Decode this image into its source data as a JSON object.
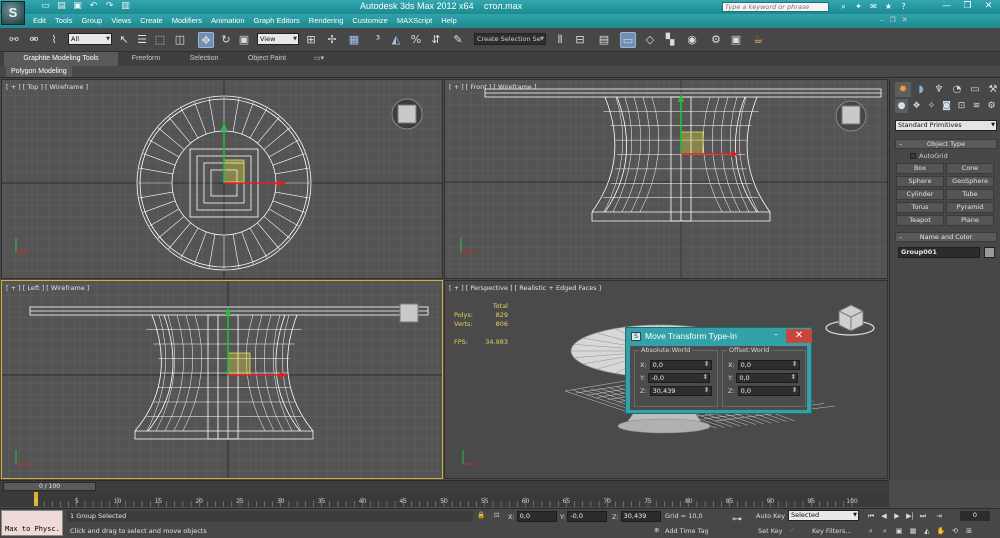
{
  "app": {
    "logo_glyph": "S",
    "title": "Autodesk 3ds Max  2012 x64",
    "file": "стол.max",
    "search_placeholder": "Type a keyword or phrase"
  },
  "menu": [
    "Edit",
    "Tools",
    "Group",
    "Views",
    "Create",
    "Modifiers",
    "Animation",
    "Graph Editors",
    "Rendering",
    "Customize",
    "MAXScript",
    "Help"
  ],
  "toolbar": {
    "selection_filter": "All",
    "ref_coord": "View",
    "named_selection": "Create Selection Se"
  },
  "ribbon": {
    "tabs": [
      "Graphite Modeling Tools",
      "Freeform",
      "Selection",
      "Object Paint"
    ],
    "active_tab": 0,
    "panel_label": "Polygon Modeling"
  },
  "viewports": {
    "top": "[ + ] [ Top ] [ Wireframe ]",
    "front": "[ + ] [ Front ] [ Wireframe ]",
    "left": "[ + ] [ Left ] [ Wireframe ]",
    "perspective": "[ + ] [ Perspective ] [ Realistic + Edged Faces ]",
    "viewcube_top": "TOP",
    "viewcube_front": "FRONT",
    "viewcube_left": "LEFT"
  },
  "stats": {
    "total_label": "Total",
    "polys_label": "Polys:",
    "polys": "829",
    "verts_label": "Verts:",
    "verts": "806",
    "fps_label": "FPS:",
    "fps": "34,983"
  },
  "command_panel": {
    "category": "Standard Primitives",
    "object_type_title": "Object Type",
    "autogrid": "AutoGrid",
    "buttons": [
      "Box",
      "Cone",
      "Sphere",
      "GeoSphere",
      "Cylinder",
      "Tube",
      "Torus",
      "Pyramid",
      "Teapot",
      "Plane"
    ],
    "name_color_title": "Name and Color",
    "object_name": "Group001"
  },
  "dialog": {
    "title": "Move Transform Type-In",
    "absolute_label": "Absolute:World",
    "offset_label": "Offset:World",
    "absolute": {
      "x": "0,0",
      "y": "-0,0",
      "z": "30,439"
    },
    "offset": {
      "x": "0,0",
      "y": "0,0",
      "z": "0,0"
    },
    "x_label": "X:",
    "y_label": "Y:",
    "z_label": "Z:"
  },
  "timeline": {
    "slider_text": "0 / 100",
    "ticks": [
      "0",
      "5",
      "10",
      "15",
      "20",
      "25",
      "30",
      "35",
      "40",
      "45",
      "50",
      "55",
      "60",
      "65",
      "70",
      "75",
      "80",
      "85",
      "90",
      "95",
      "100"
    ]
  },
  "status": {
    "maxscript": "Max to Physc.",
    "selection": "1 Group Selected",
    "prompt": "Click and drag to select and move objects",
    "x_label": "X:",
    "x": "0,0",
    "y_label": "Y:",
    "y": "-0,0",
    "z_label": "Z:",
    "z": "30,439",
    "grid": "Grid = 10,0",
    "add_time_tag": "Add Time Tag",
    "auto_key": "Auto Key",
    "set_key": "Set Key",
    "key_mode": "Selected",
    "key_filters": "Key Filters...",
    "frame": "0"
  },
  "colors": {
    "titlebar": "#1b8a92",
    "viewport_bg": "#545454",
    "active_border": "#d4b23a",
    "gizmo_x": "#e02020",
    "gizmo_y": "#22c03a",
    "gizmo_plane": "#e8e04a",
    "stats_text": "#e8d05c",
    "close_button": "#c9463d"
  }
}
